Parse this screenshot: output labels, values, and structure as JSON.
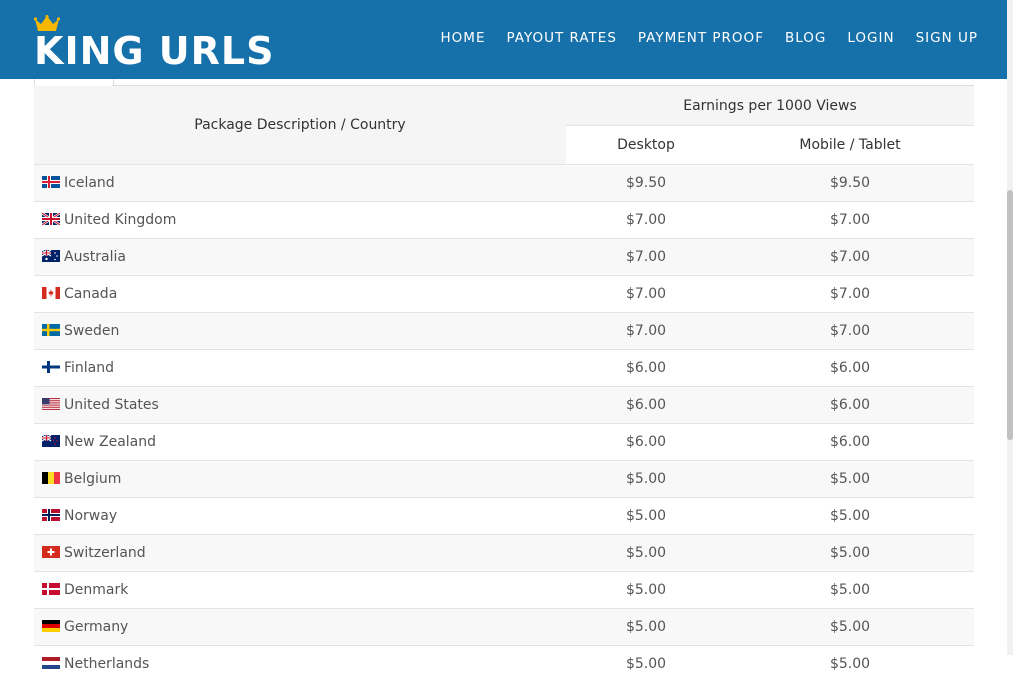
{
  "header": {
    "logo_text": "KING URLS",
    "nav": [
      "HOME",
      "PAYOUT RATES",
      "PAYMENT PROOF",
      "BLOG",
      "LOGIN",
      "SIGN UP"
    ]
  },
  "colors": {
    "header_bg": "#1670a9",
    "crown": "#f5b700"
  },
  "table": {
    "col_package": "Package Description / Country",
    "col_earnings": "Earnings per 1000 Views",
    "col_desktop": "Desktop",
    "col_mobile": "Mobile / Tablet",
    "rows": [
      {
        "country": "Iceland",
        "flag": "flag-iceland-icon",
        "desktop": "$9.50",
        "mobile": "$9.50"
      },
      {
        "country": "United Kingdom",
        "flag": "flag-uk-icon",
        "desktop": "$7.00",
        "mobile": "$7.00"
      },
      {
        "country": "Australia",
        "flag": "flag-australia-icon",
        "desktop": "$7.00",
        "mobile": "$7.00"
      },
      {
        "country": "Canada",
        "flag": "flag-canada-icon",
        "desktop": "$7.00",
        "mobile": "$7.00"
      },
      {
        "country": "Sweden",
        "flag": "flag-sweden-icon",
        "desktop": "$7.00",
        "mobile": "$7.00"
      },
      {
        "country": "Finland",
        "flag": "flag-finland-icon",
        "desktop": "$6.00",
        "mobile": "$6.00"
      },
      {
        "country": "United States",
        "flag": "flag-us-icon",
        "desktop": "$6.00",
        "mobile": "$6.00"
      },
      {
        "country": "New Zealand",
        "flag": "flag-newzealand-icon",
        "desktop": "$6.00",
        "mobile": "$6.00"
      },
      {
        "country": "Belgium",
        "flag": "flag-belgium-icon",
        "desktop": "$5.00",
        "mobile": "$5.00"
      },
      {
        "country": "Norway",
        "flag": "flag-norway-icon",
        "desktop": "$5.00",
        "mobile": "$5.00"
      },
      {
        "country": "Switzerland",
        "flag": "flag-switzerland-icon",
        "desktop": "$5.00",
        "mobile": "$5.00"
      },
      {
        "country": "Denmark",
        "flag": "flag-denmark-icon",
        "desktop": "$5.00",
        "mobile": "$5.00"
      },
      {
        "country": "Germany",
        "flag": "flag-germany-icon",
        "desktop": "$5.00",
        "mobile": "$5.00"
      },
      {
        "country": "Netherlands",
        "flag": "flag-netherlands-icon",
        "desktop": "$5.00",
        "mobile": "$5.00"
      }
    ]
  }
}
